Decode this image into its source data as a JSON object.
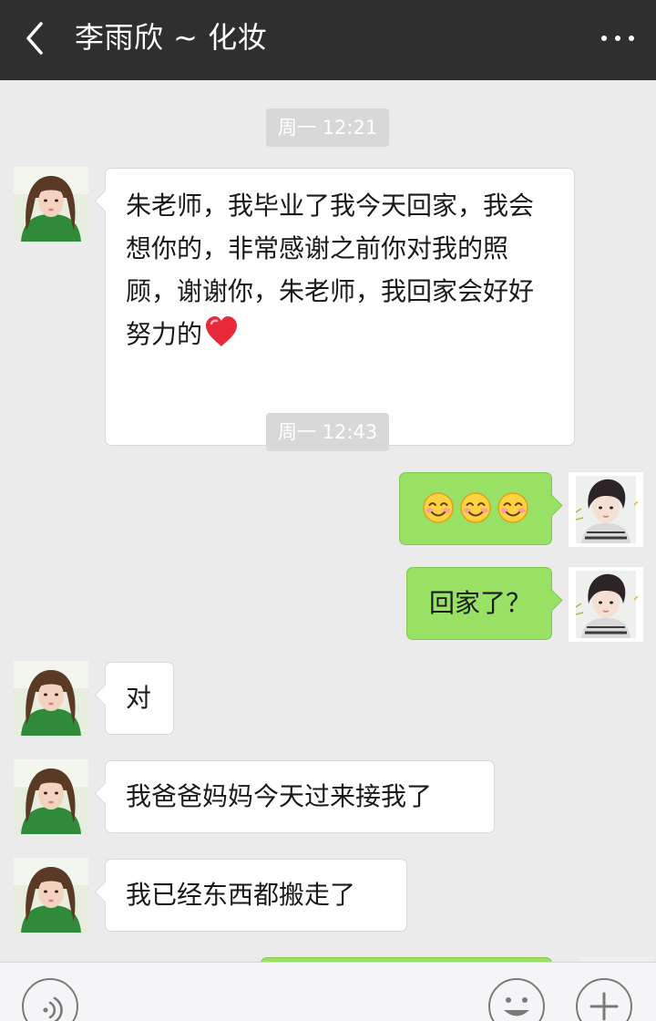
{
  "header": {
    "title": "李雨欣 ~ 化妆",
    "back_icon": "chevron-left-icon",
    "more_icon": "more-dots-icon"
  },
  "colors": {
    "header_bg": "#2f2f2f",
    "chat_bg": "#ebebeb",
    "incoming_bubble": "#ffffff",
    "outgoing_bubble": "#98e165",
    "timestamp_bg": "#d8d8d8"
  },
  "messages": [
    {
      "type": "timestamp",
      "text": "周一 12:21"
    },
    {
      "type": "incoming",
      "text": "朱老师，我毕业了我今天回家，我会想你的，非常感谢之前你对我的照顾，谢谢你，朱老师，我回家会好好努力的",
      "emoji": "heart"
    },
    {
      "type": "timestamp",
      "text": "周一 12:43"
    },
    {
      "type": "outgoing",
      "text": "",
      "emoji": "smiling-face x3"
    },
    {
      "type": "outgoing",
      "text": "回家了？"
    },
    {
      "type": "incoming",
      "text": "对"
    },
    {
      "type": "incoming",
      "text": "我爸爸妈妈今天过来接我了"
    },
    {
      "type": "incoming",
      "text": "我已经东西都搬走了"
    },
    {
      "type": "outgoing",
      "text": ""
    }
  ],
  "input_bar": {
    "voice_icon": "voice-icon",
    "emoji_icon": "emoji-face-icon",
    "plus_icon": "plus-icon"
  }
}
